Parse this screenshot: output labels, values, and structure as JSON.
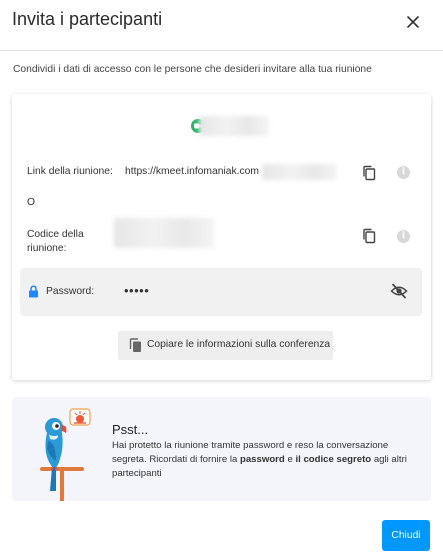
{
  "dialog": {
    "title": "Invita i partecipanti",
    "close_icon": "close-icon",
    "subtitle": "Condividi i dati di accesso con le persone che desideri invitare alla tua riunione"
  },
  "card": {
    "meeting_name_icon": "video-camera-icon",
    "link": {
      "label": "Link della riunione:",
      "value": "https://kmeet.infomaniak.com",
      "copy_icon": "copy-icon",
      "info_icon": "info-icon",
      "info_glyph": "i"
    },
    "separator": "O",
    "code": {
      "label": "Codice della riunione:",
      "copy_icon": "copy-icon",
      "info_icon": "info-icon",
      "info_glyph": "i"
    },
    "password": {
      "lock_icon": "lock-icon",
      "label": "Password:",
      "value": "•••••",
      "toggle_icon": "eye-off-icon"
    },
    "copy_conference": {
      "icon": "copy-icon",
      "label": "Copiare le informazioni sulla conferenza"
    }
  },
  "tip": {
    "illustration": "parrot-illustration",
    "title": "Psst...",
    "body_1": "Hai protetto la riunione tramite password e reso la conversazione segreta. Ricordati di fornire la ",
    "body_bold_1": "password",
    "body_2": " e ",
    "body_bold_2": "il codice segreto",
    "body_3": " agli altri partecipanti"
  },
  "footer": {
    "close_label": "Chiudi"
  },
  "colors": {
    "accent": "#0098ff",
    "camera_green": "#28b56a",
    "lock_blue": "#1e88ff",
    "tip_background": "#f4f5fb"
  }
}
